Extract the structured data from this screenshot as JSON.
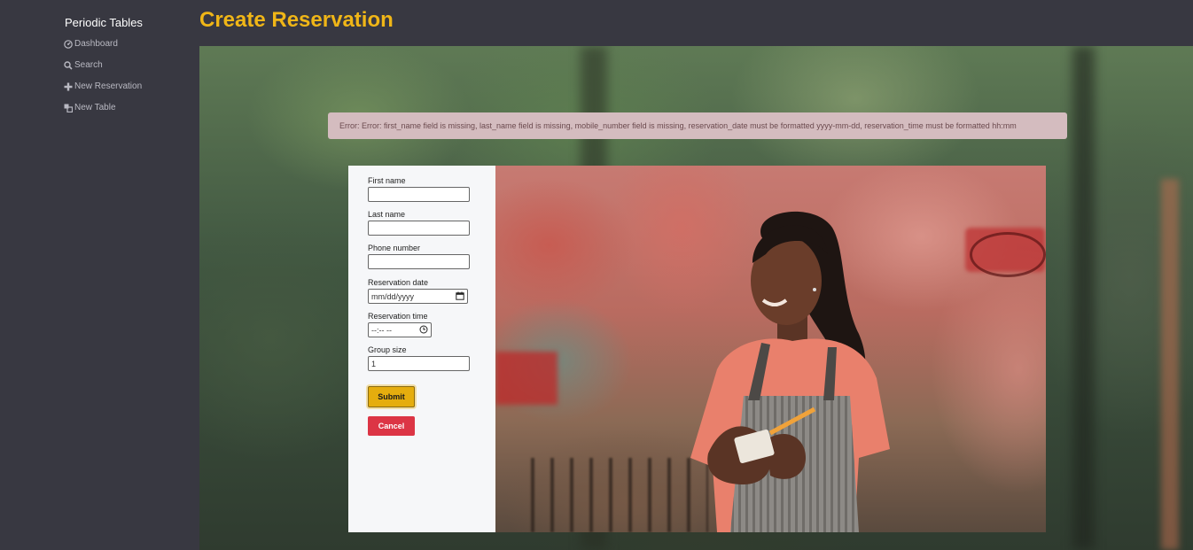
{
  "sidebar": {
    "brand": "Periodic Tables",
    "items": [
      {
        "label": "Dashboard",
        "icon": "dashboard-icon"
      },
      {
        "label": "Search",
        "icon": "search-icon"
      },
      {
        "label": "New Reservation",
        "icon": "plus-icon"
      },
      {
        "label": "New Table",
        "icon": "table-icon"
      }
    ]
  },
  "page": {
    "title": "Create Reservation"
  },
  "alert": {
    "message": "Error: Error: first_name field is missing, last_name field is missing, mobile_number field is missing, reservation_date must be formatted yyyy-mm-dd, reservation_time must be formatted hh:mm"
  },
  "form": {
    "first_name": {
      "label": "First name",
      "value": ""
    },
    "last_name": {
      "label": "Last name",
      "value": ""
    },
    "mobile_number": {
      "label": "Phone number",
      "value": ""
    },
    "reservation_date": {
      "label": "Reservation date",
      "placeholder": "mm/dd/yyyy"
    },
    "reservation_time": {
      "label": "Reservation time",
      "placeholder": "--:-- --"
    },
    "people": {
      "label": "Group size",
      "value": "1"
    },
    "submit_label": "Submit",
    "cancel_label": "Cancel"
  },
  "colors": {
    "background": "#383841",
    "title": "#f0b617",
    "submit": "#e5ad0e",
    "cancel": "#dc3545",
    "alert_bg": "#d4bcbf"
  }
}
